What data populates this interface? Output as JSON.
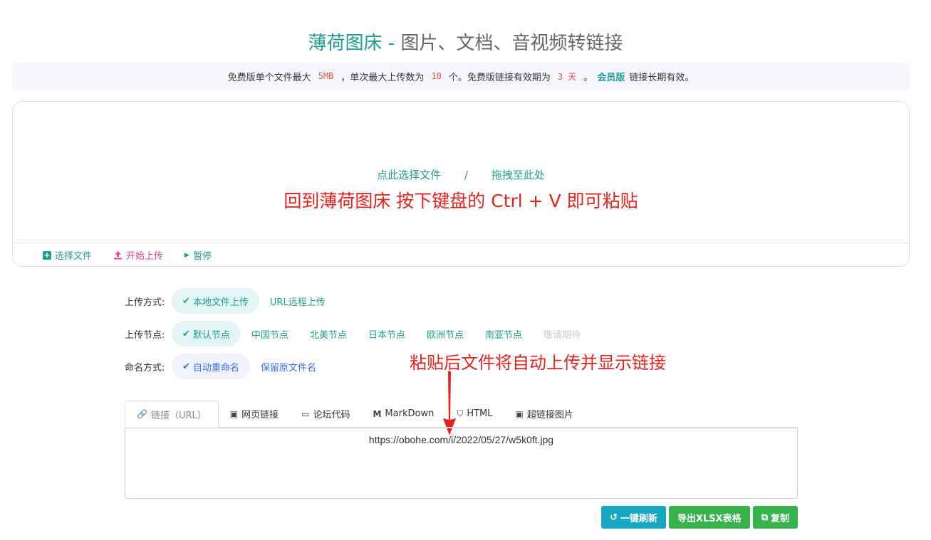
{
  "header": {
    "brand": "薄荷图床",
    "separator": " - ",
    "subtitle": "图片、文档、音视频转链接"
  },
  "notice": {
    "part1": "免费版单个文件最大",
    "size": "5MB",
    "part2": "，单次最大上传数为",
    "count": "10",
    "part3": "个。免费版链接有效期为",
    "days": "3 天",
    "part4": "。",
    "vip": "会员版",
    "part5": "链接长期有效。"
  },
  "dropzone": {
    "select_text": "点此选择文件",
    "slash": "/",
    "drag_text": "拖拽至此处",
    "paste_hint": "回到薄荷图床 按下键盘的 Ctrl + V 即可粘贴",
    "select_button": "选择文件",
    "start_button": "开始上传",
    "pause_button": "暂停"
  },
  "upload_method": {
    "label": "上传方式:",
    "options": [
      "本地文件上传",
      "URL远程上传"
    ]
  },
  "upload_node": {
    "label": "上传节点:",
    "options": [
      "默认节点",
      "中国节点",
      "北美节点",
      "日本节点",
      "欧洲节点",
      "南亚节点",
      "敬请期待"
    ]
  },
  "naming": {
    "label": "命名方式:",
    "options": [
      "自动重命名",
      "保留原文件名"
    ]
  },
  "annotation": "粘贴后文件将自动上传并显示链接",
  "tabs": [
    "链接（URL）",
    "网页链接",
    "论坛代码",
    "MarkDown",
    "HTML",
    "超链接图片"
  ],
  "output_value": "https://obohe.com/i/2022/05/27/w5k0ft.jpg",
  "actions": {
    "refresh": "一键刷新",
    "export": "导出XLSX表格",
    "copy": "复制"
  },
  "colors": {
    "brand": "#1f9d8f",
    "annotation_red": "#e8221b",
    "refresh_button": "#17a7c3",
    "green_button": "#37b24d"
  }
}
